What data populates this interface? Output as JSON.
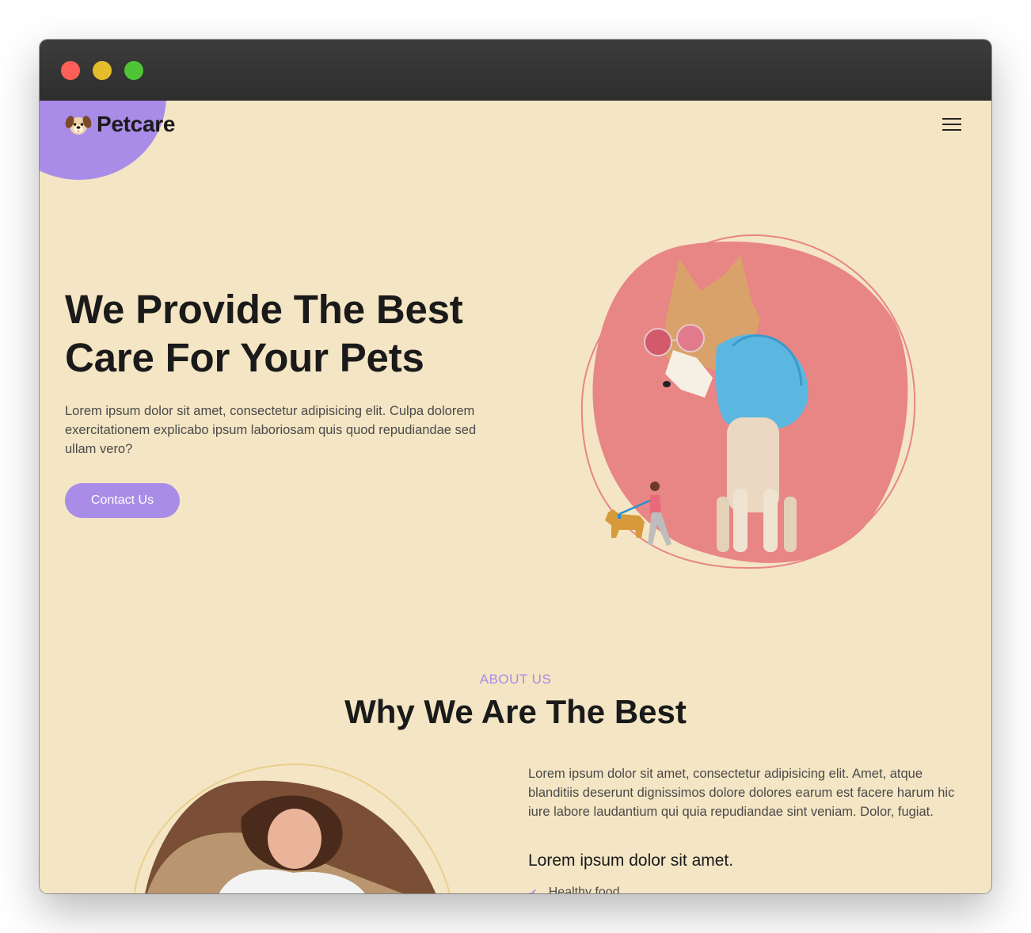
{
  "colors": {
    "page_bg": "#f4e5c4",
    "accent": "#a98ce8",
    "blob_pink": "#e88585",
    "titlebar": "#333333",
    "traffic_red": "#fe5f57",
    "traffic_yellow": "#e4bd2c",
    "traffic_green": "#4fc536"
  },
  "window": {
    "controls": [
      "close",
      "minimize",
      "maximize"
    ]
  },
  "nav": {
    "logo_icon": "dog-face-icon",
    "brand": "Petcare",
    "menu_icon": "hamburger-menu-icon"
  },
  "hero": {
    "title": "We Provide The Best Care For Your Pets",
    "description": "Lorem ipsum dolor sit amet, consectetur adipisicing elit. Culpa dolorem exercitationem explicabo ipsum laboriosam quis quod repudiandae sed ullam vero?",
    "cta_label": "Contact Us",
    "image": "dog-with-sunglasses-and-feather-boa",
    "illustration": "person-walking-dog-icon"
  },
  "about": {
    "kicker": "ABOUT US",
    "title": "Why We Are The Best",
    "image": "woman-with-pet-photo",
    "description": "Lorem ipsum dolor sit amet, consectetur adipisicing elit. Amet, atque blanditiis deserunt dignissimos dolore dolores earum est facere harum hic iure labore laudantium qui quia repudiandae sint veniam. Dolor, fugiat.",
    "subtitle": "Lorem ipsum dolor sit amet.",
    "list": [
      "Healthy food"
    ]
  }
}
